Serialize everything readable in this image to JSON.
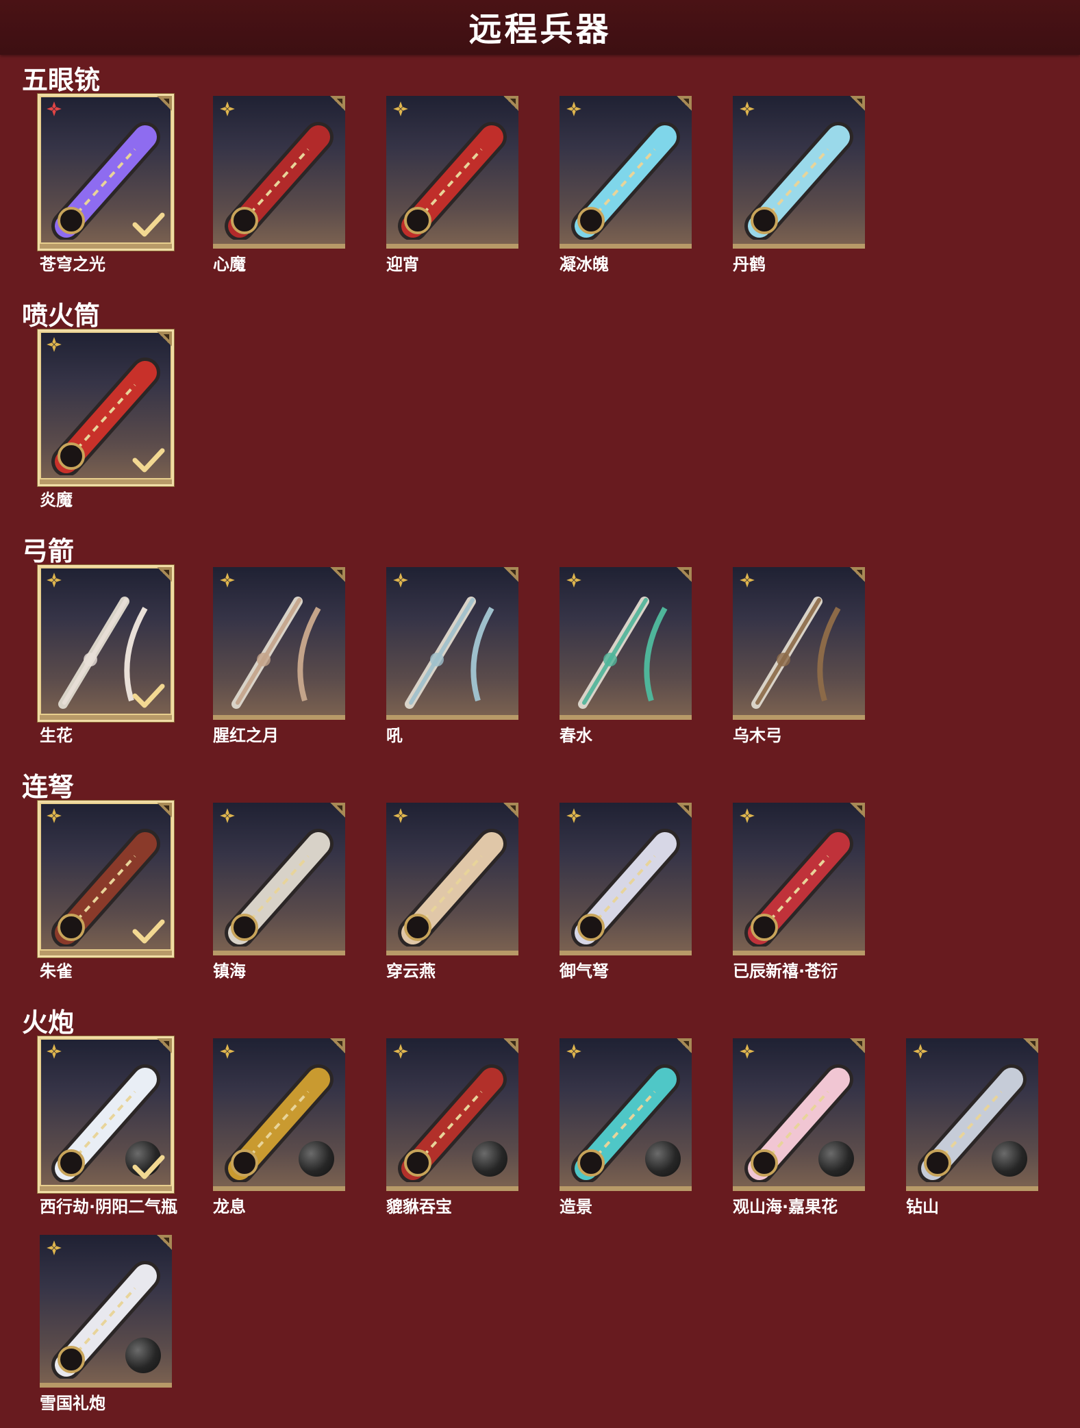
{
  "page_title": "远程兵器",
  "colors": {
    "background": "#681b1f",
    "header": "#3d0f12",
    "card_border": "#b89a68",
    "selected_outline": "#f1dda6"
  },
  "sections": [
    {
      "title": "五眼铳",
      "items": [
        {
          "name": "苍穹之光",
          "rarity_icon": "red-flower-icon",
          "selected": true,
          "accent": "#8e6cf0"
        },
        {
          "name": "心魔",
          "rarity_icon": "gold-flower-icon",
          "selected": false,
          "accent": "#b22a2a"
        },
        {
          "name": "迎宵",
          "rarity_icon": "gold-flower-icon",
          "selected": false,
          "accent": "#c02e2a"
        },
        {
          "name": "凝冰魄",
          "rarity_icon": "gold-flower-icon",
          "selected": false,
          "accent": "#7fd6ea"
        },
        {
          "name": "丹鹤",
          "rarity_icon": "gold-flower-icon",
          "selected": false,
          "accent": "#9ad9ea"
        }
      ]
    },
    {
      "title": "喷火筒",
      "items": [
        {
          "name": "炎魔",
          "rarity_icon": "gold-flower-icon",
          "selected": true,
          "accent": "#c8312a"
        }
      ]
    },
    {
      "title": "弓箭",
      "items": [
        {
          "name": "生花",
          "rarity_icon": "gold-flower-icon",
          "selected": true,
          "accent": "#e9e0d8"
        },
        {
          "name": "腥红之月",
          "rarity_icon": "gold-flower-icon",
          "selected": false,
          "accent": "#c4a48a"
        },
        {
          "name": "吼",
          "rarity_icon": "gold-flower-icon",
          "selected": false,
          "accent": "#9fc0cc"
        },
        {
          "name": "春水",
          "rarity_icon": "gold-flower-icon",
          "selected": false,
          "accent": "#4fb59a"
        },
        {
          "name": "乌木弓",
          "rarity_icon": "gold-flower-icon",
          "selected": false,
          "accent": "#8c6a48"
        }
      ]
    },
    {
      "title": "连弩",
      "items": [
        {
          "name": "朱雀",
          "rarity_icon": "gold-flower-icon",
          "selected": true,
          "accent": "#8a3a2a"
        },
        {
          "name": "镇海",
          "rarity_icon": "gold-flower-icon",
          "selected": false,
          "accent": "#d8d2c8"
        },
        {
          "name": "穿云燕",
          "rarity_icon": "gold-flower-icon",
          "selected": false,
          "accent": "#e0c7a8"
        },
        {
          "name": "御气弩",
          "rarity_icon": "gold-flower-icon",
          "selected": false,
          "accent": "#d7d7e6"
        },
        {
          "name": "已辰新禧·苍衍",
          "rarity_icon": "gold-flower-icon",
          "selected": false,
          "accent": "#c0323a"
        }
      ]
    },
    {
      "title": "火炮",
      "items": [
        {
          "name": "西行劫·阴阳二气瓶",
          "rarity_icon": "gold-flower-icon",
          "selected": true,
          "ammo": true,
          "accent": "#e9eef5"
        },
        {
          "name": "龙息",
          "rarity_icon": "gold-flower-icon",
          "selected": false,
          "ammo": true,
          "accent": "#c99a30"
        },
        {
          "name": "貔貅吞宝",
          "rarity_icon": "gold-flower-icon",
          "selected": false,
          "ammo": true,
          "accent": "#b2302a"
        },
        {
          "name": "造景",
          "rarity_icon": "gold-flower-icon",
          "selected": false,
          "ammo": true,
          "accent": "#4fc7c7"
        },
        {
          "name": "观山海·嘉果花",
          "rarity_icon": "gold-flower-icon",
          "selected": false,
          "ammo": true,
          "accent": "#f1c6d3"
        },
        {
          "name": "钻山",
          "rarity_icon": "gold-flower-icon",
          "selected": false,
          "ammo": true,
          "accent": "#c6ccd8"
        },
        {
          "name": "雪国礼炮",
          "rarity_icon": "gold-flower-icon",
          "selected": false,
          "ammo": true,
          "accent": "#e8e8ee"
        }
      ]
    }
  ]
}
